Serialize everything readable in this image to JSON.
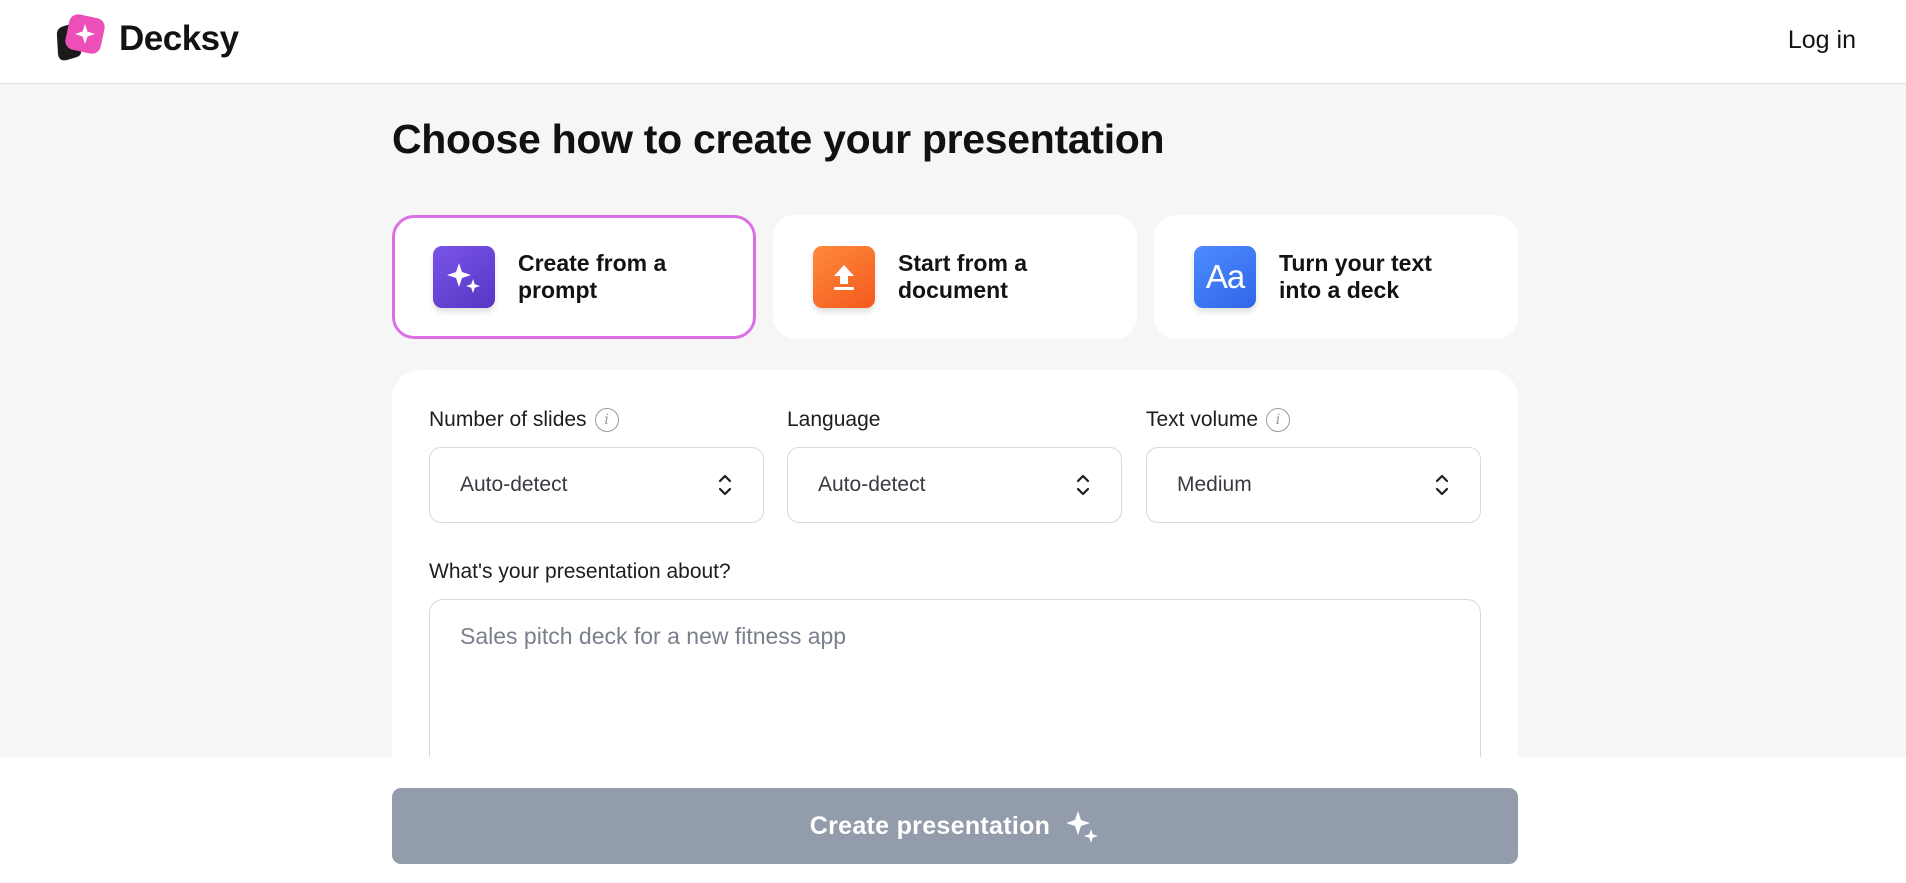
{
  "header": {
    "brand_name": "Decksy",
    "login_label": "Log in"
  },
  "main": {
    "title": "Choose how to create your presentation",
    "modes": [
      {
        "label": "Create from a\nprompt",
        "icon": "sparkles-icon",
        "selected": true
      },
      {
        "label": "Start from a\ndocument",
        "icon": "upload-document-icon",
        "selected": false
      },
      {
        "label": "Turn your text\ninto a deck",
        "icon": "text-aa-icon",
        "selected": false
      }
    ],
    "icon_text_glyph": "Aa",
    "form": {
      "slides": {
        "label": "Number of slides",
        "value": "Auto-detect"
      },
      "language": {
        "label": "Language",
        "value": "Auto-detect"
      },
      "volume": {
        "label": "Text volume",
        "value": "Medium"
      },
      "about": {
        "label": "What's your presentation about?",
        "placeholder": "Sales pitch deck for a new fitness app"
      }
    }
  },
  "footer": {
    "create_label": "Create presentation"
  },
  "colors": {
    "accent_border": "#dd6fe6",
    "button_disabled": "#939cab",
    "prompt_icon": "#6a46d8",
    "document_icon": "#f7702b",
    "text_icon": "#3f7bf5"
  }
}
